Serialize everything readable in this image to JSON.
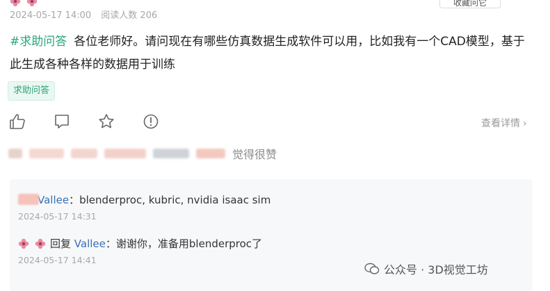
{
  "post": {
    "date": "2024-05-17 14:00",
    "views": "阅读人数 206",
    "top_button_label": "收藏问它",
    "tag_link": "#求助问答",
    "question_text": "各位老师好。请问现在有哪些仿真数据生成软件可以用，比如我有一个CAD模型，基于此生成各种各样的数据用于训练",
    "tag_chip": "求助问答",
    "view_details": "查看详情",
    "likes_suffix": "觉得很赞"
  },
  "actions": {
    "icons": [
      "thumbs-up-icon",
      "comment-icon",
      "star-icon",
      "report-icon"
    ]
  },
  "comments": [
    {
      "author_visible": "Vallee",
      "text": "blenderproc, kubric, nvidia isaac sim",
      "time": "2024-05-17 14:31"
    },
    {
      "reply_label": "回复",
      "reply_to": "Vallee",
      "text": "谢谢你，准备用blenderproc了",
      "time": "2024-05-17 14:41"
    }
  ],
  "watermark": {
    "text": "公众号 · 3D视觉工坊"
  },
  "colors": {
    "accent": "#2ba47e",
    "link": "#3a6fb8",
    "muted": "#a8a8a8",
    "comment_bg": "#f7f8f9"
  }
}
